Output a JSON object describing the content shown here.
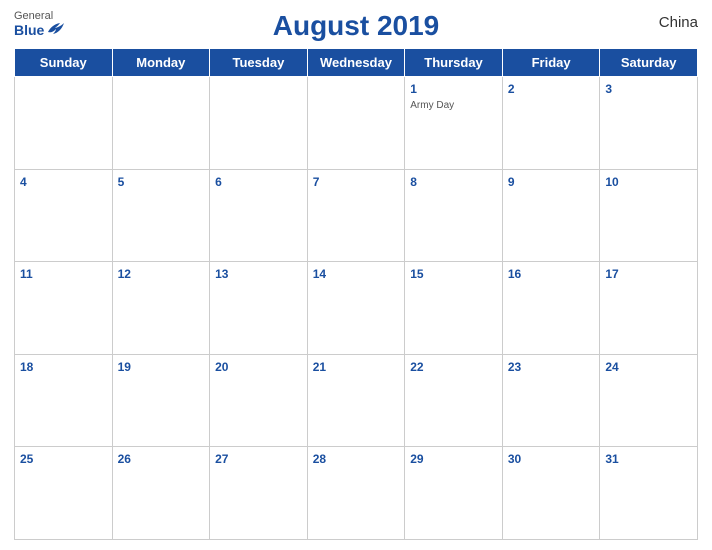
{
  "header": {
    "logo_general": "General",
    "logo_blue": "Blue",
    "month_title": "August 2019",
    "country": "China"
  },
  "days_of_week": [
    "Sunday",
    "Monday",
    "Tuesday",
    "Wednesday",
    "Thursday",
    "Friday",
    "Saturday"
  ],
  "weeks": [
    [
      {
        "day": "",
        "empty": true
      },
      {
        "day": "",
        "empty": true
      },
      {
        "day": "",
        "empty": true
      },
      {
        "day": "",
        "empty": true
      },
      {
        "day": "1",
        "event": "Army Day"
      },
      {
        "day": "2"
      },
      {
        "day": "3"
      }
    ],
    [
      {
        "day": "4"
      },
      {
        "day": "5"
      },
      {
        "day": "6"
      },
      {
        "day": "7"
      },
      {
        "day": "8"
      },
      {
        "day": "9"
      },
      {
        "day": "10"
      }
    ],
    [
      {
        "day": "11"
      },
      {
        "day": "12"
      },
      {
        "day": "13"
      },
      {
        "day": "14"
      },
      {
        "day": "15"
      },
      {
        "day": "16"
      },
      {
        "day": "17"
      }
    ],
    [
      {
        "day": "18"
      },
      {
        "day": "19"
      },
      {
        "day": "20"
      },
      {
        "day": "21"
      },
      {
        "day": "22"
      },
      {
        "day": "23"
      },
      {
        "day": "24"
      }
    ],
    [
      {
        "day": "25"
      },
      {
        "day": "26"
      },
      {
        "day": "27"
      },
      {
        "day": "28"
      },
      {
        "day": "29"
      },
      {
        "day": "30"
      },
      {
        "day": "31"
      }
    ]
  ]
}
